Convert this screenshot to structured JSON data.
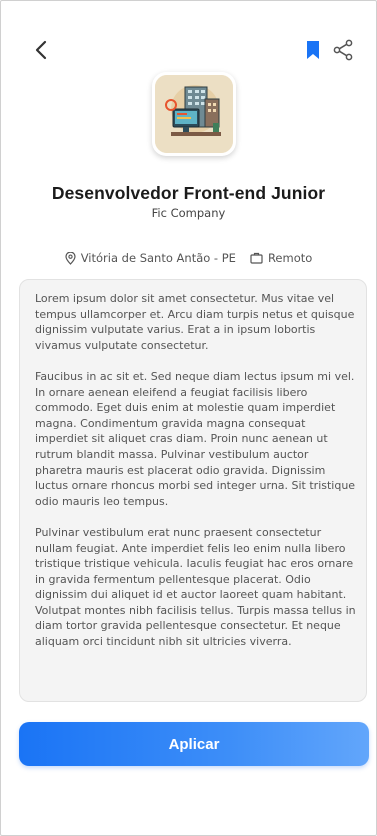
{
  "header": {
    "back_icon": "chevron-left-icon",
    "bookmark_icon": "bookmark-icon",
    "share_icon": "share-icon",
    "accent_color": "#1a74f5"
  },
  "job": {
    "title": "Desenvolvedor Front-end Junior",
    "company": "Fic Company",
    "location": "Vitória de Santo Antão - PE",
    "location_icon": "map-pin-icon",
    "work_mode": "Remoto",
    "work_mode_icon": "briefcase-icon",
    "description": [
      "Lorem ipsum dolor sit amet consectetur. Mus vitae vel tempus ullamcorper et. Arcu diam turpis netus et quisque dignissim vulputate varius. Erat a in ipsum lobortis vivamus vulputate consectetur.",
      "Faucibus in ac sit et. Sed neque diam lectus ipsum mi vel. In ornare aenean eleifend a feugiat facilisis libero commodo. Eget duis enim at molestie quam imperdiet magna. Condimentum gravida magna consequat imperdiet sit aliquet cras diam. Proin nunc aenean ut rutrum blandit massa. Pulvinar vestibulum auctor pharetra mauris est placerat odio gravida. Dignissim luctus ornare rhoncus morbi sed integer urna. Sit tristique odio mauris leo tempus.",
      "Pulvinar vestibulum erat nunc praesent consectetur nullam feugiat. Ante imperdiet felis leo enim nulla libero tristique tristique vehicula. Iaculis feugiat hac eros ornare in gravida fermentum pellentesque placerat. Odio dignissim dui aliquet id et auctor laoreet quam habitant. Volutpat montes nibh facilisis tellus. Turpis massa tellus in diam tortor gravida pellentesque consectetur. Et neque aliquam orci tincidunt nibh sit ultricies viverra."
    ]
  },
  "actions": {
    "apply_label": "Aplicar"
  }
}
